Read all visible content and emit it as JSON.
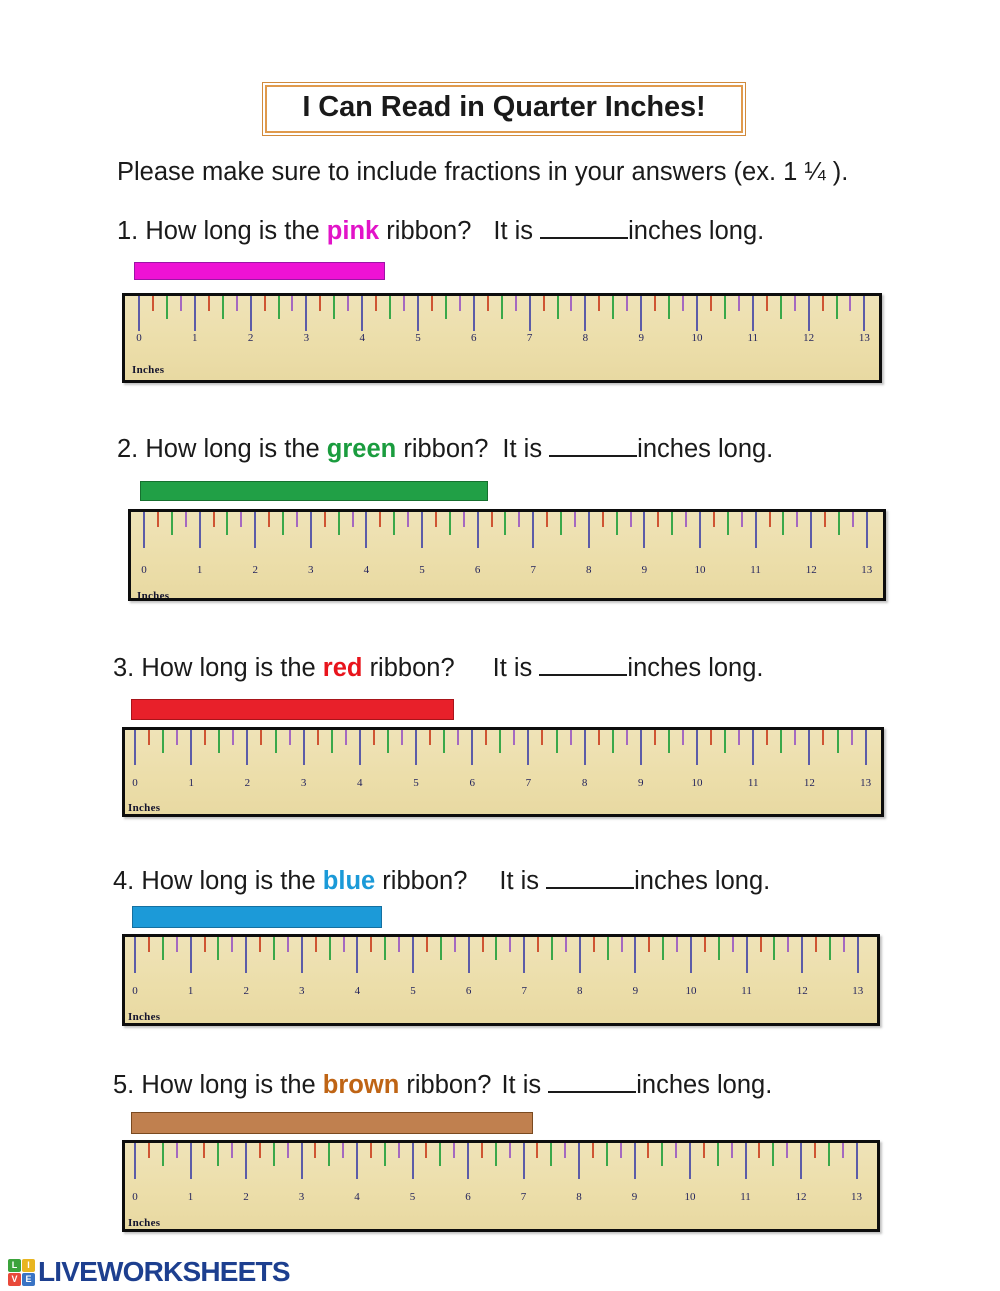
{
  "page": {
    "title": "I Can Read in Quarter Inches!",
    "instruction": "Please make sure to include fractions in your answers (ex. 1 ¼ ).",
    "background": "#ffffff",
    "title_border_color": "#e09a4c"
  },
  "questions": [
    {
      "number": "1.",
      "prefix": "How long is the",
      "color_word": "pink",
      "suffix": "ribbon?",
      "answer_prefix": "It is",
      "answer_blank": "________",
      "answer_suffix": "inches long.",
      "word_color": "#e213c8",
      "ribbon": {
        "color": "#ee12d4",
        "border_color": "#9b14a6",
        "length_inches": 4.5
      }
    },
    {
      "number": "2.",
      "prefix": "How long is the",
      "color_word": "green",
      "suffix": "ribbon?",
      "answer_prefix": "It is",
      "answer_blank": "________",
      "answer_suffix": "inches long.",
      "word_color": "#1a9c3e",
      "ribbon": {
        "color": "#21a046",
        "border_color": "#16702f",
        "length_inches": 6.25
      }
    },
    {
      "number": "3.",
      "prefix": "How long is the",
      "color_word": "red",
      "suffix": "ribbon?",
      "answer_prefix": "It is",
      "answer_blank": "________",
      "answer_suffix": "inches long.",
      "word_color": "#e8141c",
      "ribbon": {
        "color": "#e8202a",
        "border_color": "#a8141a",
        "length_inches": 5.75
      }
    },
    {
      "number": "4.",
      "prefix": "How long is the",
      "color_word": "blue",
      "suffix": "ribbon?",
      "answer_prefix": "It is",
      "answer_blank": "________",
      "answer_suffix": "inches long.",
      "word_color": "#1b9ad8",
      "ribbon": {
        "color": "#1c9ad8",
        "border_color": "#1570a0",
        "length_inches": 4.5
      }
    },
    {
      "number": "5.",
      "prefix": "How long is the",
      "color_word": "brown",
      "suffix": "ribbon?",
      "answer_prefix": "It is",
      "answer_blank": "________",
      "answer_suffix": "inches long.",
      "word_color": "#bf6414",
      "ribbon": {
        "color": "#c0804f",
        "border_color": "#7a4a20",
        "length_inches": 7.25
      }
    }
  ],
  "ruler": {
    "unit_label": "Inches",
    "tick_labels": [
      "0",
      "1",
      "2",
      "3",
      "4",
      "5",
      "6",
      "7",
      "8",
      "9",
      "10",
      "11",
      "12",
      "13"
    ],
    "max_inches": 13,
    "face_color": "#ecdfb0",
    "border_color": "#0d0d0d",
    "tick_colors": {
      "whole": "#5c5ca8",
      "half": "#3aa84a",
      "quarter": "#cf5533",
      "three_quarter": "#a569c0"
    }
  },
  "footer": {
    "brand": "LIVEWORKSHEETS",
    "logo_letters": [
      "L",
      "I",
      "V",
      "E"
    ],
    "logo_colors": [
      "#3ba33b",
      "#e8b520",
      "#e8493a",
      "#3a74c4"
    ],
    "brand_color": "#1d3f8f"
  }
}
